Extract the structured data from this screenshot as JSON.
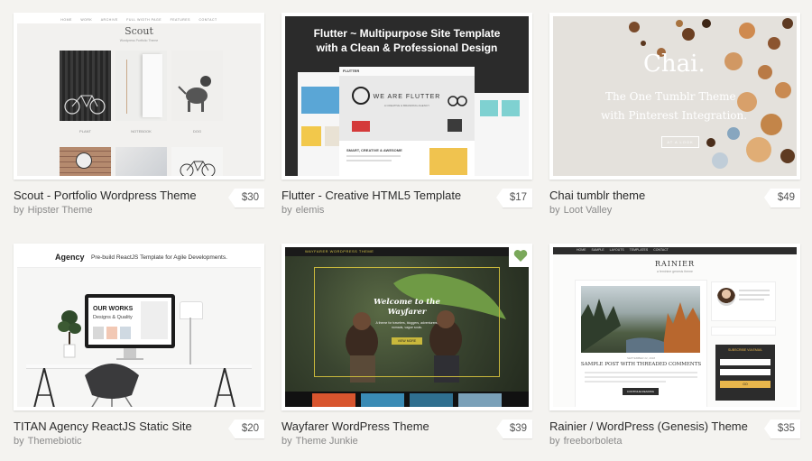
{
  "colors": {
    "background": "#f4f3f0",
    "heart": "#7aa85a"
  },
  "items": [
    {
      "title": "Scout - Portfolio Wordpress Theme",
      "author": "Hipster Theme",
      "price": "$30",
      "preview": {
        "nav": [
          "HOME",
          "WORK",
          "ARCHIVE",
          "FULL WIDTH PAGE",
          "FEATURES",
          "CONTACT"
        ],
        "brand": "Scout",
        "tagline": "Wordpress Portfolio Theme",
        "captions": [
          "PLANT",
          "NOTEBOOK",
          "DOG"
        ]
      }
    },
    {
      "title": "Flutter - Creative HTML5 Template",
      "author": "elemis",
      "price": "$17",
      "preview": {
        "headline": "Flutter ~ Multipurpose Site Template",
        "subheadline": "with a Clean & Professional Design",
        "brand": "FLUTTER",
        "hero": "WE ARE FLUTTER",
        "hero_sub": "A CREATIVE & BRANDING AGENCY",
        "section": "SMART, CREATIVE & AWESOME"
      }
    },
    {
      "title": "Chai tumblr theme",
      "author": "Loot Valley",
      "price": "$49",
      "preview": {
        "brand": "Chai.",
        "line1": "The One Tumblr Theme",
        "line2": "with Pinterest Integration.",
        "button": "AT A LOOK"
      }
    },
    {
      "title": "TITAN Agency ReactJS Static Site",
      "author": "Themebiotic",
      "price": "$20",
      "preview": {
        "brand": "Agency",
        "tagline": "Pre-build ReactJS Template for Agile Developments.",
        "screen_line1": "OUR WORKS",
        "screen_line2": "Designs & Quality"
      }
    },
    {
      "title": "Wayfarer WordPress Theme",
      "author": "Theme Junkie",
      "price": "$39",
      "favorited": true,
      "preview": {
        "topbar": "WAYFARER WORDPRESS THEME",
        "headline_1": "Welcome to the",
        "headline_2": "Wayfarer",
        "subtext": "A theme for travelers, bloggers, adventurers, nomads, vague souls.",
        "button": "VIEW MORE"
      }
    },
    {
      "title": "Rainier / WordPress (Genesis) Theme",
      "author": "freeborboleta",
      "price": "$35",
      "preview": {
        "nav": [
          "HOME",
          "SAMPLE",
          "LAYOUTS",
          "TEMPLATES",
          "CONTACT"
        ],
        "brand": "RAINIER",
        "tagline": "a feminine genesis theme",
        "post_date": "SEPTEMBER 22, 2018",
        "post_title": "SAMPLE POST WITH THREADED COMMENTS",
        "continue": "CONTINUE READING",
        "subscribe": "SUBSCRIBE VIA EMAIL",
        "go": "GO"
      }
    }
  ]
}
